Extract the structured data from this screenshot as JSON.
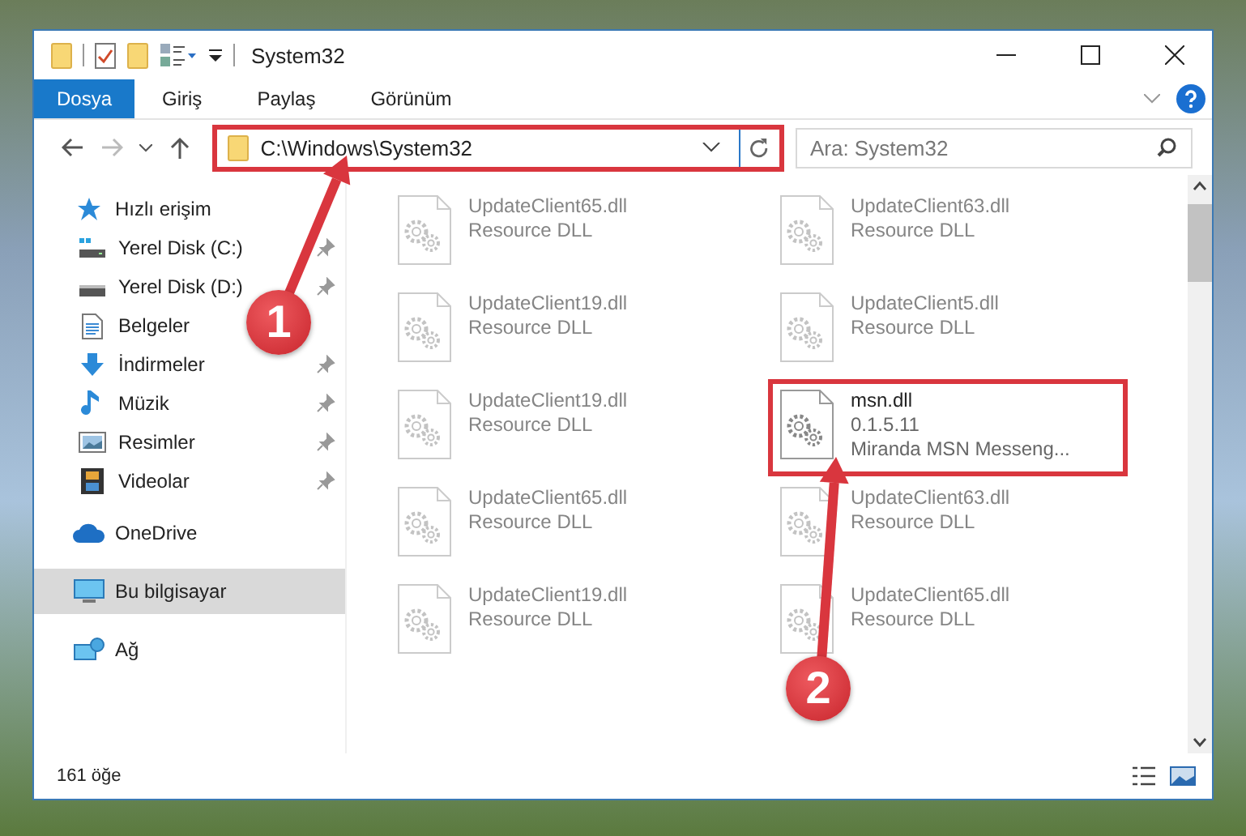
{
  "window": {
    "title": "System32"
  },
  "ribbon": {
    "tabs": [
      {
        "label": "Dosya",
        "selected": true
      },
      {
        "label": "Giriş",
        "selected": false
      },
      {
        "label": "Paylaş",
        "selected": false
      },
      {
        "label": "Görünüm",
        "selected": false
      }
    ]
  },
  "address_bar": {
    "path": "C:\\Windows\\System32",
    "highlighted": true
  },
  "search": {
    "placeholder": "Ara: System32"
  },
  "sidebar": {
    "sections": [
      {
        "label": "Hızlı erişim",
        "kind": "star",
        "selected": false,
        "children": [
          {
            "label": "Yerel Disk (C:)",
            "kind": "drivec",
            "pinned": true,
            "selected": false
          },
          {
            "label": "Yerel Disk (D:)",
            "kind": "drive",
            "pinned": true,
            "selected": false
          },
          {
            "label": "Belgeler",
            "kind": "document",
            "pinned": false,
            "selected": false
          },
          {
            "label": "İndirmeler",
            "kind": "download",
            "pinned": true,
            "selected": false
          },
          {
            "label": "Müzik",
            "kind": "music",
            "pinned": true,
            "selected": false
          },
          {
            "label": "Resimler",
            "kind": "picture",
            "pinned": true,
            "selected": false
          },
          {
            "label": "Videolar",
            "kind": "film",
            "pinned": true,
            "selected": false
          }
        ]
      },
      {
        "label": "OneDrive",
        "kind": "cloud",
        "selected": false
      },
      {
        "label": "Bu bilgisayar",
        "kind": "computer",
        "selected": true
      },
      {
        "label": "Ağ",
        "kind": "network",
        "selected": false
      }
    ]
  },
  "files": [
    {
      "name": "UpdateClient65.dll",
      "lines": [
        "Resource DLL"
      ],
      "blurred": true,
      "highlighted": false
    },
    {
      "name": "UpdateClient63.dll",
      "lines": [
        "Resource DLL"
      ],
      "blurred": true,
      "highlighted": false
    },
    {
      "name": "UpdateClient19.dll",
      "lines": [
        "Resource DLL"
      ],
      "blurred": true,
      "highlighted": false
    },
    {
      "name": "UpdateClient5.dll",
      "lines": [
        "Resource DLL"
      ],
      "blurred": true,
      "highlighted": false
    },
    {
      "name": "UpdateClient19.dll",
      "lines": [
        "Resource DLL"
      ],
      "blurred": true,
      "highlighted": false
    },
    {
      "name": "msn.dll",
      "lines": [
        "0.1.5.11",
        "Miranda MSN Messeng..."
      ],
      "blurred": false,
      "highlighted": true
    },
    {
      "name": "UpdateClient65.dll",
      "lines": [
        "Resource DLL"
      ],
      "blurred": true,
      "highlighted": false
    },
    {
      "name": "UpdateClient63.dll",
      "lines": [
        "Resource DLL"
      ],
      "blurred": true,
      "highlighted": false
    },
    {
      "name": "UpdateClient19.dll",
      "lines": [
        "Resource DLL"
      ],
      "blurred": true,
      "highlighted": false
    },
    {
      "name": "UpdateClient65.dll",
      "lines": [
        "Resource DLL"
      ],
      "blurred": true,
      "highlighted": false
    }
  ],
  "annotations": [
    {
      "label": "1"
    },
    {
      "label": "2"
    }
  ],
  "status_bar": {
    "count": "161 öğe"
  }
}
